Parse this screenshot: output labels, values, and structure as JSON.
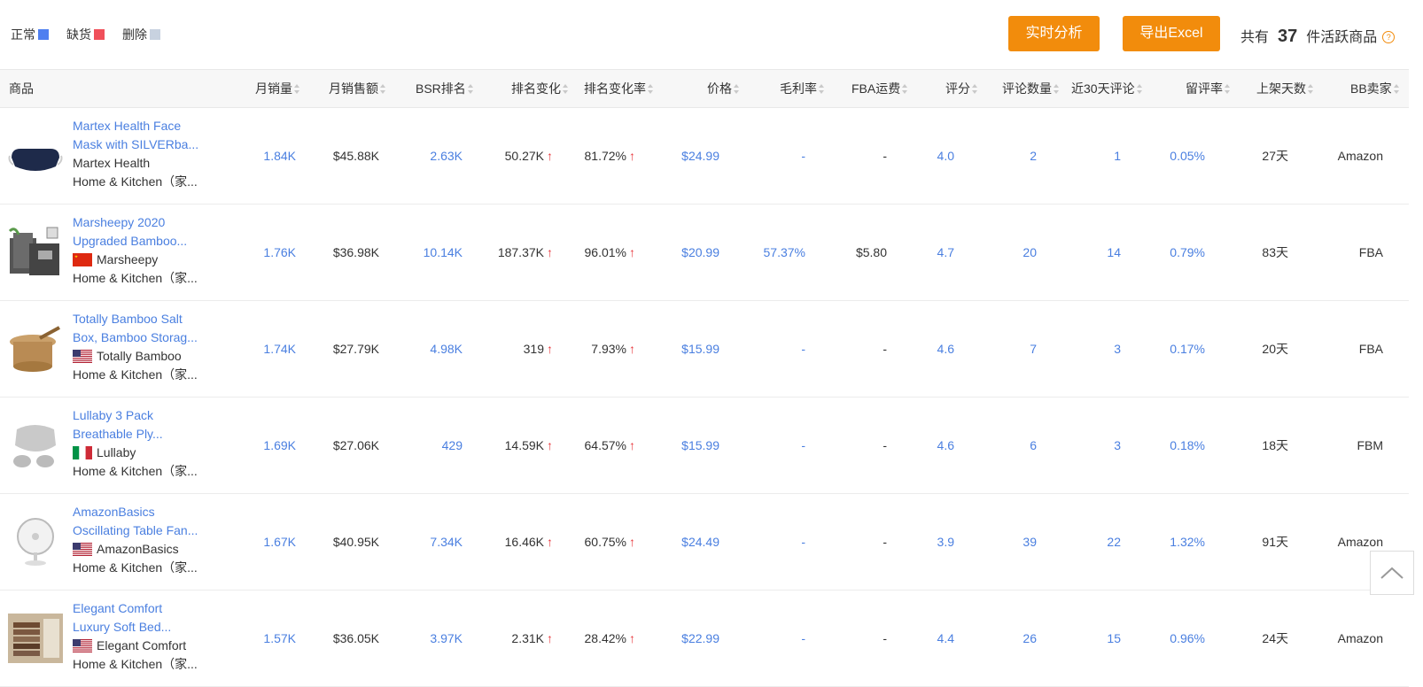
{
  "legend": {
    "normal_label": "正常",
    "normal_color": "#4f7ff0",
    "stockout_label": "缺货",
    "stockout_color": "#f0505a",
    "deleted_label": "删除",
    "deleted_color": "#c8d2e0"
  },
  "toolbar": {
    "analysis_label": "实时分析",
    "export_label": "导出Excel",
    "count_prefix": "共有",
    "count_value": "37",
    "count_suffix": "件活跃商品",
    "help_glyph": "?"
  },
  "columns": {
    "product": "商品",
    "monthly_sales": "月销量",
    "monthly_revenue": "月销售额",
    "bsr_rank": "BSR排名",
    "rank_change": "排名变化",
    "rank_change_rate": "排名变化率",
    "price": "价格",
    "gross_margin": "毛利率",
    "fba_fee": "FBA运费",
    "rating": "评分",
    "review_count": "评论数量",
    "reviews_30d": "近30天评论",
    "review_rate": "留评率",
    "days_listed": "上架天数",
    "bb_seller": "BB卖家"
  },
  "rows": [
    {
      "title_line1": "Martex Health Face",
      "title_line2": "Mask with SILVERba...",
      "brand": "Martex Health",
      "flag": "none",
      "category": "Home & Kitchen（家...",
      "thumb": "mask-navy-icon",
      "monthly_sales": "1.84K",
      "monthly_revenue": "$45.88K",
      "bsr_rank": "2.63K",
      "rank_change": "50.27K",
      "rank_change_rate": "81.72%",
      "arrow": "↑",
      "price": "$24.99",
      "gross_margin": "-",
      "fba_fee": "-",
      "rating": "4.0",
      "review_count": "2",
      "reviews_30d": "1",
      "review_rate": "0.05%",
      "days_listed": "27天",
      "bb_seller": "Amazon"
    },
    {
      "title_line1": "Marsheepy 2020",
      "title_line2": "Upgraded Bamboo...",
      "brand": "Marsheepy",
      "flag": "cn",
      "category": "Home & Kitchen（家...",
      "thumb": "charcoal-bags-icon",
      "monthly_sales": "1.76K",
      "monthly_revenue": "$36.98K",
      "bsr_rank": "10.14K",
      "rank_change": "187.37K",
      "rank_change_rate": "96.01%",
      "arrow": "↑",
      "price": "$20.99",
      "gross_margin": "57.37%",
      "fba_fee": "$5.80",
      "rating": "4.7",
      "review_count": "20",
      "reviews_30d": "14",
      "review_rate": "0.79%",
      "days_listed": "83天",
      "bb_seller": "FBA"
    },
    {
      "title_line1": "Totally Bamboo Salt",
      "title_line2": "Box, Bamboo Storag...",
      "brand": "Totally Bamboo",
      "flag": "us",
      "category": "Home & Kitchen（家...",
      "thumb": "bamboo-box-icon",
      "monthly_sales": "1.74K",
      "monthly_revenue": "$27.79K",
      "bsr_rank": "4.98K",
      "rank_change": "319",
      "rank_change_rate": "7.93%",
      "arrow": "↑",
      "price": "$15.99",
      "gross_margin": "-",
      "fba_fee": "-",
      "rating": "4.6",
      "review_count": "7",
      "reviews_30d": "3",
      "review_rate": "0.17%",
      "days_listed": "20天",
      "bb_seller": "FBA"
    },
    {
      "title_line1": "Lullaby 3 Pack",
      "title_line2": "Breathable Ply...",
      "brand": "Lullaby",
      "flag": "it",
      "category": "Home & Kitchen（家...",
      "thumb": "mask-grey-icon",
      "monthly_sales": "1.69K",
      "monthly_revenue": "$27.06K",
      "bsr_rank": "429",
      "rank_change": "14.59K",
      "rank_change_rate": "64.57%",
      "arrow": "↑",
      "price": "$15.99",
      "gross_margin": "-",
      "fba_fee": "-",
      "rating": "4.6",
      "review_count": "6",
      "reviews_30d": "3",
      "review_rate": "0.18%",
      "days_listed": "18天",
      "bb_seller": "FBM"
    },
    {
      "title_line1": "AmazonBasics",
      "title_line2": "Oscillating Table Fan...",
      "brand": "AmazonBasics",
      "flag": "us",
      "category": "Home & Kitchen（家...",
      "thumb": "table-fan-icon",
      "monthly_sales": "1.67K",
      "monthly_revenue": "$40.95K",
      "bsr_rank": "7.34K",
      "rank_change": "16.46K",
      "rank_change_rate": "60.75%",
      "arrow": "↑",
      "price": "$24.49",
      "gross_margin": "-",
      "fba_fee": "-",
      "rating": "3.9",
      "review_count": "39",
      "reviews_30d": "22",
      "review_rate": "1.32%",
      "days_listed": "91天",
      "bb_seller": "Amazon"
    },
    {
      "title_line1": "Elegant Comfort",
      "title_line2": "Luxury Soft Bed...",
      "brand": "Elegant Comfort",
      "flag": "us",
      "category": "Home & Kitchen（家...",
      "thumb": "bed-sheets-icon",
      "monthly_sales": "1.57K",
      "monthly_revenue": "$36.05K",
      "bsr_rank": "3.97K",
      "rank_change": "2.31K",
      "rank_change_rate": "28.42%",
      "arrow": "↑",
      "price": "$22.99",
      "gross_margin": "-",
      "fba_fee": "-",
      "rating": "4.4",
      "review_count": "26",
      "reviews_30d": "15",
      "review_rate": "0.96%",
      "days_listed": "24天",
      "bb_seller": "Amazon"
    }
  ]
}
